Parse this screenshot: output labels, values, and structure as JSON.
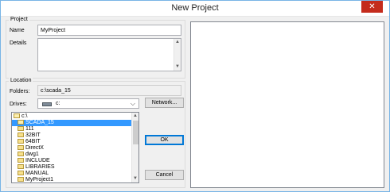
{
  "window": {
    "title": "New Project",
    "close_glyph": "✕"
  },
  "project": {
    "group_label": "Project",
    "name_label": "Name",
    "name_value": "MyProject",
    "details_label": "Details",
    "details_value": ""
  },
  "location": {
    "group_label": "Location",
    "folders_label": "Folders:",
    "folders_value": "c:\\scada_15",
    "drives_label": "Drives:",
    "drive_value": "c:",
    "network_button": "Network..."
  },
  "folder_tree": {
    "items": [
      {
        "label": "c:\\",
        "icon": "open-folder-icon",
        "indent": 0,
        "selected": false
      },
      {
        "label": "SCADA_15",
        "icon": "open-folder-icon",
        "indent": 1,
        "selected": true
      },
      {
        "label": "111",
        "icon": "folder-icon",
        "indent": 1,
        "selected": false
      },
      {
        "label": "32BIT",
        "icon": "folder-icon",
        "indent": 1,
        "selected": false
      },
      {
        "label": "64BIT",
        "icon": "folder-icon",
        "indent": 1,
        "selected": false
      },
      {
        "label": "DirectX",
        "icon": "folder-icon",
        "indent": 1,
        "selected": false
      },
      {
        "label": "dwg1",
        "icon": "folder-icon",
        "indent": 1,
        "selected": false
      },
      {
        "label": "INCLUDE",
        "icon": "folder-icon",
        "indent": 1,
        "selected": false
      },
      {
        "label": "LIBRARIES",
        "icon": "folder-icon",
        "indent": 1,
        "selected": false
      },
      {
        "label": "MANUAL",
        "icon": "folder-icon",
        "indent": 1,
        "selected": false
      },
      {
        "label": "MyProject1",
        "icon": "folder-icon",
        "indent": 1,
        "selected": false
      }
    ]
  },
  "buttons": {
    "ok": "OK",
    "cancel": "Cancel"
  },
  "colors": {
    "accent": "#0078d7",
    "selection": "#3399ff",
    "close": "#c42b1c"
  }
}
